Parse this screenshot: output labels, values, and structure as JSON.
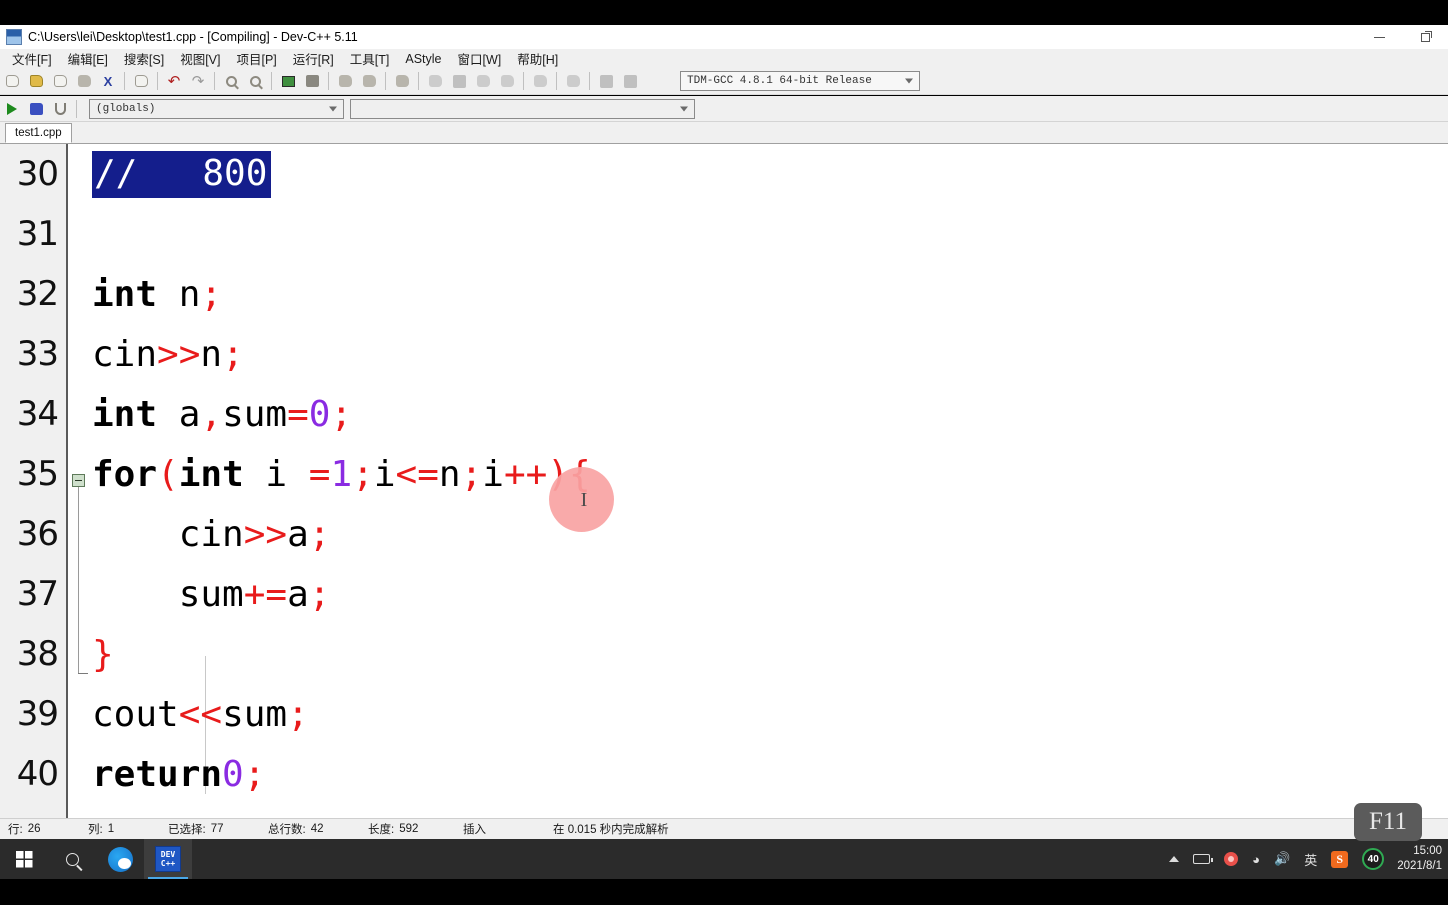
{
  "window": {
    "title": "C:\\Users\\lei\\Desktop\\test1.cpp - [Compiling] - Dev-C++ 5.11",
    "minimize_label": "Minimize",
    "maximize_label": "Restore"
  },
  "menubar": {
    "items": [
      {
        "label": "文件[F]"
      },
      {
        "label": "编辑[E]"
      },
      {
        "label": "搜索[S]"
      },
      {
        "label": "视图[V]"
      },
      {
        "label": "项目[P]"
      },
      {
        "label": "运行[R]"
      },
      {
        "label": "工具[T]"
      },
      {
        "label": "AStyle"
      },
      {
        "label": "窗口[W]"
      },
      {
        "label": "帮助[H]"
      }
    ]
  },
  "toolbar": {
    "close_glyph": "X",
    "undo_glyph": "↰",
    "redo_glyph": "↱",
    "compiler_combo_value": "TDM-GCC 4.8.1 64-bit Release",
    "globals_combo_value": "(globals)",
    "second_combo_value": ""
  },
  "tabs": {
    "items": [
      {
        "label": "test1.cpp",
        "active": true
      }
    ]
  },
  "editor": {
    "first_line_number": 30,
    "selection_color": "#141e8c",
    "keyword_color": "#000000",
    "operator_color": "#e81b1b",
    "number_color": "#8a2be2",
    "lines": [
      {
        "number": "30",
        "selected_text": "//   800"
      },
      {
        "number": "31",
        "text": ""
      },
      {
        "number": "32",
        "text": "int n;"
      },
      {
        "number": "33",
        "text": "cin>>n;"
      },
      {
        "number": "34",
        "text": "int a,sum=0;"
      },
      {
        "number": "35",
        "text": "for(int i = 1;i<=n;i++){"
      },
      {
        "number": "36",
        "text": "    cin>>a;"
      },
      {
        "number": "37",
        "text": "    sum+=a;"
      },
      {
        "number": "38",
        "text": "}"
      },
      {
        "number": "39",
        "text": "cout<<sum;"
      },
      {
        "number": "40",
        "text": "return 0;"
      }
    ]
  },
  "statusbar": {
    "row_label": "行:",
    "row_value": "26",
    "col_label": "列:",
    "col_value": "1",
    "selected_label": "已选择:",
    "selected_value": "77",
    "totallines_label": "总行数:",
    "totallines_value": "42",
    "length_label": "长度:",
    "length_value": "592",
    "mode": "插入",
    "parse_message": "在 0.015 秒内完成解析"
  },
  "overlay": {
    "key_badge": "F11"
  },
  "taskbar": {
    "start_label": "Start",
    "search_label": "Search",
    "qq_label": "QQ Browser",
    "dev_label_top": "DEV",
    "dev_label_bottom": "C++",
    "tray": {
      "ime_glyph": "英",
      "sogou_glyph": "S",
      "battery_badge": "40",
      "volume_glyph": "🔊",
      "wifi_glyph": "📶"
    },
    "clock": {
      "time": "15:00",
      "date": "2021/8/1"
    }
  }
}
